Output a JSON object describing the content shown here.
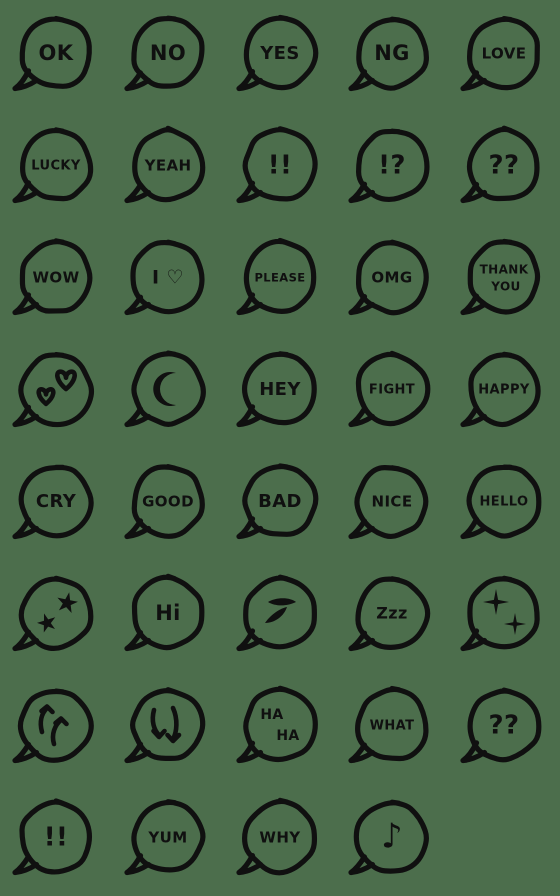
{
  "sheet": {
    "title": "Hand-drawn speech bubble emoji sheet",
    "background_color": "#4c6e4c",
    "ink_color": "#101010",
    "columns": 5,
    "rows": 8,
    "total_items": 39
  },
  "items": [
    {
      "id": "ok",
      "row": 1,
      "col": 1,
      "kind": "text",
      "text": "OK",
      "size": "sz-2",
      "name": "emoji-bubble-ok"
    },
    {
      "id": "no",
      "row": 1,
      "col": 2,
      "kind": "text",
      "text": "NO",
      "size": "sz-2",
      "name": "emoji-bubble-no"
    },
    {
      "id": "yes",
      "row": 1,
      "col": 3,
      "kind": "text",
      "text": "YES",
      "size": "sz-3",
      "name": "emoji-bubble-yes"
    },
    {
      "id": "ng",
      "row": 1,
      "col": 4,
      "kind": "text",
      "text": "NG",
      "size": "sz-2",
      "name": "emoji-bubble-ng"
    },
    {
      "id": "love",
      "row": 1,
      "col": 5,
      "kind": "text",
      "text": "LOVE",
      "size": "sz-4",
      "name": "emoji-bubble-love"
    },
    {
      "id": "lucky",
      "row": 2,
      "col": 1,
      "kind": "text",
      "text": "LUCKY",
      "size": "sz-5",
      "name": "emoji-bubble-lucky"
    },
    {
      "id": "yeah",
      "row": 2,
      "col": 2,
      "kind": "text",
      "text": "YEAH",
      "size": "sz-4",
      "name": "emoji-bubble-yeah"
    },
    {
      "id": "excl2",
      "row": 2,
      "col": 3,
      "kind": "text",
      "text": "!!",
      "size": "sz-punct",
      "name": "emoji-bubble-double-exclamation"
    },
    {
      "id": "interro",
      "row": 2,
      "col": 4,
      "kind": "text",
      "text": "!?",
      "size": "sz-punct",
      "name": "emoji-bubble-exclamation-question"
    },
    {
      "id": "quest2a",
      "row": 2,
      "col": 5,
      "kind": "text",
      "text": "??",
      "size": "sz-punct",
      "name": "emoji-bubble-double-question"
    },
    {
      "id": "wow",
      "row": 3,
      "col": 1,
      "kind": "text",
      "text": "WOW",
      "size": "sz-4",
      "name": "emoji-bubble-wow"
    },
    {
      "id": "iheart",
      "row": 3,
      "col": 2,
      "kind": "text",
      "text": "I ♡",
      "size": "sz-heart",
      "name": "emoji-bubble-i-love"
    },
    {
      "id": "please",
      "row": 3,
      "col": 3,
      "kind": "text",
      "text": "PLEASE",
      "size": "sz-6",
      "name": "emoji-bubble-please"
    },
    {
      "id": "omg",
      "row": 3,
      "col": 4,
      "kind": "text",
      "text": "OMG",
      "size": "sz-4",
      "name": "emoji-bubble-omg"
    },
    {
      "id": "thankyou",
      "row": 3,
      "col": 5,
      "kind": "text2",
      "text": "THANK",
      "text2": "YOU",
      "size": "sz-two-line",
      "name": "emoji-bubble-thank-you"
    },
    {
      "id": "hearts",
      "row": 4,
      "col": 1,
      "kind": "hearts",
      "text": "",
      "size": "",
      "name": "emoji-bubble-two-hearts"
    },
    {
      "id": "moon",
      "row": 4,
      "col": 2,
      "kind": "moon",
      "text": "",
      "size": "",
      "name": "emoji-bubble-crescent-moon"
    },
    {
      "id": "hey",
      "row": 4,
      "col": 3,
      "kind": "text",
      "text": "HEY",
      "size": "sz-3",
      "name": "emoji-bubble-hey"
    },
    {
      "id": "fight",
      "row": 4,
      "col": 4,
      "kind": "text",
      "text": "FIGHT",
      "size": "sz-5",
      "name": "emoji-bubble-fight"
    },
    {
      "id": "happy",
      "row": 4,
      "col": 5,
      "kind": "text",
      "text": "HAPPY",
      "size": "sz-5",
      "name": "emoji-bubble-happy"
    },
    {
      "id": "cry",
      "row": 5,
      "col": 1,
      "kind": "text",
      "text": "CRY",
      "size": "sz-3",
      "name": "emoji-bubble-cry"
    },
    {
      "id": "good",
      "row": 5,
      "col": 2,
      "kind": "text",
      "text": "GOOD",
      "size": "sz-4",
      "name": "emoji-bubble-good"
    },
    {
      "id": "bad",
      "row": 5,
      "col": 3,
      "kind": "text",
      "text": "BAD",
      "size": "sz-3",
      "name": "emoji-bubble-bad"
    },
    {
      "id": "nice",
      "row": 5,
      "col": 4,
      "kind": "text",
      "text": "NICE",
      "size": "sz-4",
      "name": "emoji-bubble-nice"
    },
    {
      "id": "hello",
      "row": 5,
      "col": 5,
      "kind": "text",
      "text": "HELLO",
      "size": "sz-5",
      "name": "emoji-bubble-hello"
    },
    {
      "id": "stars",
      "row": 6,
      "col": 1,
      "kind": "stars",
      "text": "",
      "size": "",
      "name": "emoji-bubble-two-stars"
    },
    {
      "id": "hi",
      "row": 6,
      "col": 2,
      "kind": "text",
      "text": "Hi",
      "size": "sz-2",
      "name": "emoji-bubble-hi"
    },
    {
      "id": "dashes",
      "row": 6,
      "col": 3,
      "kind": "dashes",
      "text": "",
      "size": "",
      "name": "emoji-bubble-sweat-dashes"
    },
    {
      "id": "zzz",
      "row": 6,
      "col": 4,
      "kind": "text",
      "text": "Zzz",
      "size": "sz-zzz",
      "name": "emoji-bubble-zzz"
    },
    {
      "id": "sparkles",
      "row": 6,
      "col": 5,
      "kind": "sparkles",
      "text": "",
      "size": "",
      "name": "emoji-bubble-sparkles"
    },
    {
      "id": "uparrows",
      "row": 7,
      "col": 1,
      "kind": "uparrows",
      "text": "",
      "size": "",
      "name": "emoji-bubble-up-arrows"
    },
    {
      "id": "downarrows",
      "row": 7,
      "col": 2,
      "kind": "downarrows",
      "text": "",
      "size": "",
      "name": "emoji-bubble-down-arrows"
    },
    {
      "id": "haha",
      "row": 7,
      "col": 3,
      "kind": "haha",
      "text": "HA",
      "text2": "HA",
      "size": "sz-haha",
      "name": "emoji-bubble-ha-ha"
    },
    {
      "id": "what",
      "row": 7,
      "col": 4,
      "kind": "text",
      "text": "WHAT",
      "size": "sz-5",
      "name": "emoji-bubble-what"
    },
    {
      "id": "quest2b",
      "row": 7,
      "col": 5,
      "kind": "text",
      "text": "??",
      "size": "sz-punct",
      "name": "emoji-bubble-double-question-alt"
    },
    {
      "id": "excl2b",
      "row": 8,
      "col": 1,
      "kind": "text",
      "text": "!!",
      "size": "sz-punct",
      "name": "emoji-bubble-double-exclamation-alt"
    },
    {
      "id": "yum",
      "row": 8,
      "col": 2,
      "kind": "text",
      "text": "YUM",
      "size": "sz-4",
      "name": "emoji-bubble-yum"
    },
    {
      "id": "why",
      "row": 8,
      "col": 3,
      "kind": "text",
      "text": "WHY",
      "size": "sz-4",
      "name": "emoji-bubble-why"
    },
    {
      "id": "note",
      "row": 8,
      "col": 4,
      "kind": "text",
      "text": "♪",
      "size": "sz-note",
      "name": "emoji-bubble-music-note"
    }
  ]
}
